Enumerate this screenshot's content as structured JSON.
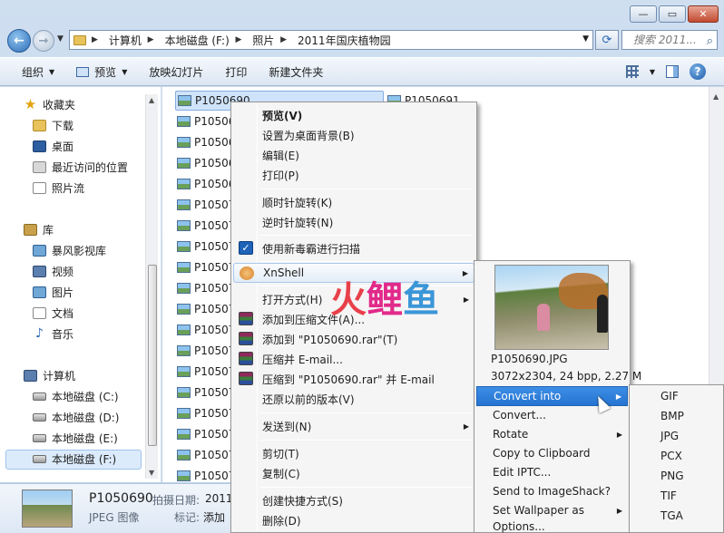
{
  "window": {
    "caption": {
      "minimize": "—",
      "maximize": "▭",
      "close": "✕"
    }
  },
  "address": {
    "crumbs": [
      "计算机",
      "本地磁盘 (F:)",
      "照片",
      "2011年国庆植物园"
    ],
    "search_placeholder": "搜索 2011..."
  },
  "toolbar": {
    "items": [
      "组织",
      "预览",
      "放映幻灯片",
      "打印",
      "新建文件夹"
    ]
  },
  "sidebar": {
    "favorites": {
      "label": "收藏夹",
      "items": [
        "下载",
        "桌面",
        "最近访问的位置",
        "照片流"
      ]
    },
    "library": {
      "label": "库",
      "items": [
        "暴风影视库",
        "视频",
        "图片",
        "文档",
        "音乐"
      ]
    },
    "computer": {
      "label": "计算机",
      "items": [
        "本地磁盘 (C:)",
        "本地磁盘 (D:)",
        "本地磁盘 (E:)",
        "本地磁盘 (F:)"
      ]
    }
  },
  "files": {
    "selected": "P1050690",
    "second_column": "P1050691",
    "list": [
      "P1050690",
      "P10506",
      "P10506",
      "P10506",
      "P10506",
      "P10507",
      "P10507",
      "P10507",
      "P10507",
      "P10507",
      "P10507",
      "P10507",
      "P10507",
      "P10507",
      "P10507",
      "P10507",
      "P10507",
      "P10507",
      "P10507",
      "P10507"
    ]
  },
  "details": {
    "name": "P1050690",
    "type": "JPEG 图像",
    "date_label": "拍摄日期:",
    "date_value": "2011",
    "tag_label": "标记:",
    "tag_value": "添加"
  },
  "context_menu": {
    "items": [
      {
        "label": "预览(V)"
      },
      {
        "label": "设置为桌面背景(B)"
      },
      {
        "label": "编辑(E)"
      },
      {
        "label": "打印(P)"
      },
      {
        "label": "顺时针旋转(K)"
      },
      {
        "label": "逆时针旋转(N)"
      },
      {
        "label": "使用新毒霸进行扫描"
      },
      {
        "label": "XnShell"
      },
      {
        "label": "打开方式(H)"
      },
      {
        "label": "添加到压缩文件(A)..."
      },
      {
        "label": "添加到 \"P1050690.rar\"(T)"
      },
      {
        "label": "压缩并 E-mail..."
      },
      {
        "label": "压缩到 \"P1050690.rar\" 并 E-mail"
      },
      {
        "label": "还原以前的版本(V)"
      },
      {
        "label": "发送到(N)"
      },
      {
        "label": "剪切(T)"
      },
      {
        "label": "复制(C)"
      },
      {
        "label": "创建快捷方式(S)"
      },
      {
        "label": "删除(D)"
      }
    ]
  },
  "xnshell_menu": {
    "preview_name": "P1050690.JPG",
    "preview_info": "3072x2304, 24 bpp, 2.27 M",
    "items": [
      "Convert into",
      "Convert...",
      "Rotate",
      "Copy to Clipboard",
      "Edit IPTC...",
      "Send to ImageShack?",
      "Set Wallpaper as",
      "Options..."
    ]
  },
  "convert_menu": {
    "items": [
      "GIF",
      "BMP",
      "JPG",
      "PCX",
      "PNG",
      "TIF",
      "TGA"
    ]
  },
  "watermark": {
    "c1": "火",
    "c2": "鲤",
    "c3": "鱼"
  }
}
